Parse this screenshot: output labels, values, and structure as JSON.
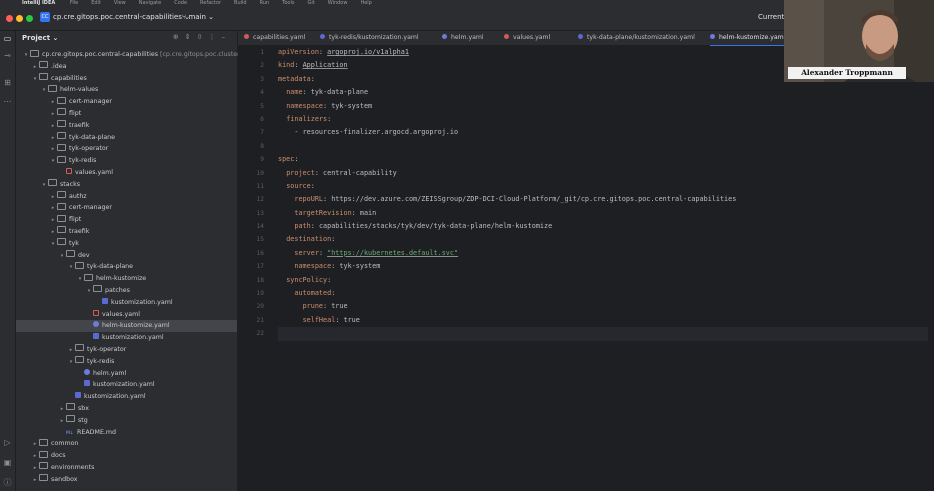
{
  "menubar": {
    "app_name": "IntelliJ IDEA",
    "items": [
      "File",
      "Edit",
      "View",
      "Navigate",
      "Code",
      "Refactor",
      "Build",
      "Run",
      "Tools",
      "Git",
      "Window",
      "Help"
    ]
  },
  "titlebar": {
    "project_badge": "CC",
    "project_name": "cp.cre.gitops.poc.central-capabilities",
    "branch": "main",
    "current_file_label": "Current"
  },
  "project_panel": {
    "title": "Project"
  },
  "tree": [
    {
      "depth": 0,
      "arrow": "▾",
      "type": "folder",
      "label": "cp.cre.gitops.poc.central-capabilities",
      "hint": " [cp.cre.gitops.poc.cluster"
    },
    {
      "depth": 1,
      "arrow": "▸",
      "type": "folder",
      "label": ".idea"
    },
    {
      "depth": 1,
      "arrow": "▾",
      "type": "folder",
      "label": "capabilities"
    },
    {
      "depth": 2,
      "arrow": "▾",
      "type": "folder",
      "label": "helm-values"
    },
    {
      "depth": 3,
      "arrow": "▸",
      "type": "folder",
      "label": "cert-manager"
    },
    {
      "depth": 3,
      "arrow": "▸",
      "type": "folder",
      "label": "flipt"
    },
    {
      "depth": 3,
      "arrow": "▸",
      "type": "folder",
      "label": "traefik"
    },
    {
      "depth": 3,
      "arrow": "▸",
      "type": "folder",
      "label": "tyk-data-plane"
    },
    {
      "depth": 3,
      "arrow": "▸",
      "type": "folder",
      "label": "tyk-operator"
    },
    {
      "depth": 3,
      "arrow": "▾",
      "type": "folder",
      "label": "tyk-redis"
    },
    {
      "depth": 4,
      "arrow": "",
      "type": "yaml",
      "label": "values.yaml"
    },
    {
      "depth": 2,
      "arrow": "▾",
      "type": "folder",
      "label": "stacks"
    },
    {
      "depth": 3,
      "arrow": "▸",
      "type": "folder",
      "label": "authz"
    },
    {
      "depth": 3,
      "arrow": "▸",
      "type": "folder",
      "label": "cert-manager"
    },
    {
      "depth": 3,
      "arrow": "▸",
      "type": "folder",
      "label": "flipt"
    },
    {
      "depth": 3,
      "arrow": "▸",
      "type": "folder",
      "label": "traefik"
    },
    {
      "depth": 3,
      "arrow": "▾",
      "type": "folder",
      "label": "tyk"
    },
    {
      "depth": 4,
      "arrow": "▾",
      "type": "folder",
      "label": "dev"
    },
    {
      "depth": 5,
      "arrow": "▾",
      "type": "folder",
      "label": "tyk-data-plane"
    },
    {
      "depth": 6,
      "arrow": "▾",
      "type": "folder",
      "label": "helm-kustomize"
    },
    {
      "depth": 7,
      "arrow": "▾",
      "type": "folder",
      "label": "patches"
    },
    {
      "depth": 8,
      "arrow": "",
      "type": "kust",
      "label": "kustomization.yaml"
    },
    {
      "depth": 7,
      "arrow": "",
      "type": "yaml",
      "label": "values.yaml"
    },
    {
      "depth": 7,
      "arrow": "",
      "type": "helm",
      "label": "helm-kustomize.yaml",
      "selected": true
    },
    {
      "depth": 7,
      "arrow": "",
      "type": "kust",
      "label": "kustomization.yaml"
    },
    {
      "depth": 5,
      "arrow": "▸",
      "type": "folder",
      "label": "tyk-operator"
    },
    {
      "depth": 5,
      "arrow": "▾",
      "type": "folder",
      "label": "tyk-redis"
    },
    {
      "depth": 6,
      "arrow": "",
      "type": "helm",
      "label": "helm.yaml"
    },
    {
      "depth": 6,
      "arrow": "",
      "type": "kust",
      "label": "kustomization.yaml"
    },
    {
      "depth": 5,
      "arrow": "",
      "type": "kust",
      "label": "kustomization.yaml"
    },
    {
      "depth": 4,
      "arrow": "▸",
      "type": "folder",
      "label": "sbx"
    },
    {
      "depth": 4,
      "arrow": "▸",
      "type": "folder",
      "label": "stg"
    },
    {
      "depth": 4,
      "arrow": "",
      "type": "md",
      "label": "README.md"
    },
    {
      "depth": 1,
      "arrow": "▸",
      "type": "folder",
      "label": "common"
    },
    {
      "depth": 1,
      "arrow": "▸",
      "type": "folder",
      "label": "docs"
    },
    {
      "depth": 1,
      "arrow": "▸",
      "type": "folder",
      "label": "environments"
    },
    {
      "depth": 1,
      "arrow": "▸",
      "type": "folder",
      "label": "sandbox"
    }
  ],
  "tabs": [
    {
      "label": "capabilities.yaml",
      "color": "#d35b5b"
    },
    {
      "label": "tyk-redis/kustomization.yaml",
      "color": "#5b6ad3"
    },
    {
      "label": "helm.yaml",
      "color": "#6e7bd9"
    },
    {
      "label": "values.yaml",
      "color": "#d35b5b"
    },
    {
      "label": "tyk-data-plane/kustomization.yaml",
      "color": "#5b6ad3"
    },
    {
      "label": "helm-kustomize.yaml",
      "color": "#6e7bd9",
      "active": true
    }
  ],
  "code_lines": [
    {
      "key": "apiVersion",
      "sep": ": ",
      "value": "argoproj.io/v1alpha1",
      "style": "u"
    },
    {
      "key": "kind",
      "sep": ": ",
      "value": "Application",
      "style": "u"
    },
    {
      "key": "metadata",
      "sep": ":",
      "value": ""
    },
    {
      "indent": "  ",
      "key": "name",
      "sep": ": ",
      "value": "tyk-data-plane"
    },
    {
      "indent": "  ",
      "key": "namespace",
      "sep": ": ",
      "value": "tyk-system"
    },
    {
      "indent": "  ",
      "key": "finalizers",
      "sep": ":",
      "value": ""
    },
    {
      "indent": "    - ",
      "key": "",
      "sep": "",
      "value": "resources-finalizer.argocd.argoproj.io"
    },
    {
      "key": "",
      "sep": "",
      "value": ""
    },
    {
      "key": "spec",
      "sep": ":",
      "value": ""
    },
    {
      "indent": "  ",
      "key": "project",
      "sep": ": ",
      "value": "central-capability"
    },
    {
      "indent": "  ",
      "key": "source",
      "sep": ":",
      "value": ""
    },
    {
      "indent": "    ",
      "key": "repoURL",
      "sep": ": ",
      "value": "https://dev.azure.com/ZEISSgroup/ZDP-DCI-Cloud-Platform/_git/cp.cre.gitops.poc.central-capabilities"
    },
    {
      "indent": "    ",
      "key": "targetRevision",
      "sep": ": ",
      "value": "main"
    },
    {
      "indent": "    ",
      "key": "path",
      "sep": ": ",
      "value": "capabilities/stacks/tyk/dev/tyk-data-plane/helm-kustomize"
    },
    {
      "indent": "  ",
      "key": "destination",
      "sep": ":",
      "value": ""
    },
    {
      "indent": "    ",
      "key": "server",
      "sep": ": ",
      "value": "\"https://kubernetes.default.svc\"",
      "style": "s"
    },
    {
      "indent": "    ",
      "key": "namespace",
      "sep": ": ",
      "value": "tyk-system"
    },
    {
      "indent": "  ",
      "key": "syncPolicy",
      "sep": ":",
      "value": ""
    },
    {
      "indent": "    ",
      "key": "automated",
      "sep": ":",
      "value": ""
    },
    {
      "indent": "      ",
      "key": "prune",
      "sep": ": ",
      "value": "true"
    },
    {
      "indent": "      ",
      "key": "selfHeal",
      "sep": ": ",
      "value": "true"
    },
    {
      "key": "",
      "sep": "",
      "value": "",
      "current": true
    }
  ],
  "webcam": {
    "name": "Alexander Troppmann"
  }
}
